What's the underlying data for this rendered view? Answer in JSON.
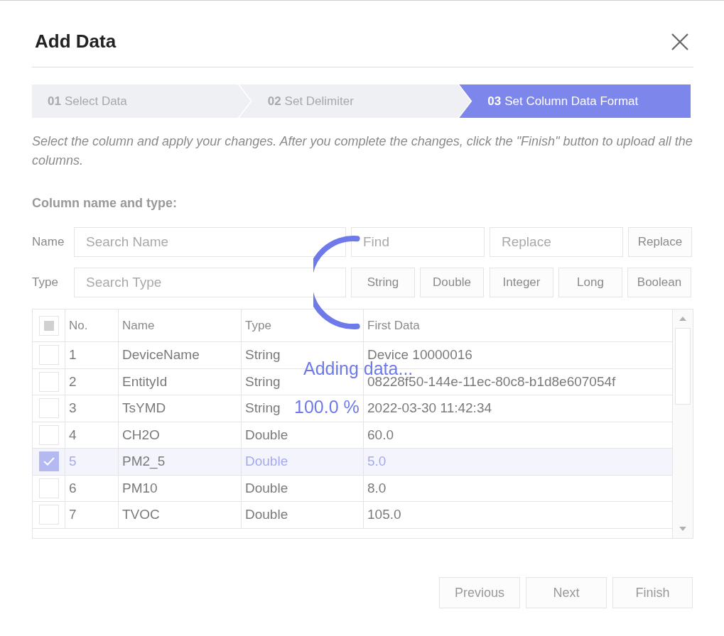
{
  "dialog": {
    "title": "Add Data"
  },
  "steps": [
    {
      "number": "01",
      "label": "Select Data",
      "selected": false
    },
    {
      "number": "02",
      "label": "Set Delimiter",
      "selected": false
    },
    {
      "number": "03",
      "label": "Set Column Data Format",
      "selected": true
    }
  ],
  "description": "Select the column and apply your changes. After you complete the changes, click the \"Finish\" button to upload all the columns.",
  "section_title": "Column name and type:",
  "name_row": {
    "label": "Name",
    "search": {
      "placeholder": "Search Name"
    },
    "find": {
      "placeholder": "Find"
    },
    "replace": {
      "placeholder": "Replace"
    },
    "button": "Replace"
  },
  "type_row": {
    "label": "Type",
    "search": {
      "placeholder": "Search Type"
    },
    "buttons": [
      "String",
      "Double",
      "Integer",
      "Long",
      "Boolean"
    ]
  },
  "table": {
    "select_all": {
      "partial": true
    },
    "columns": [
      "No.",
      "Name",
      "Type",
      "First Data"
    ],
    "rows": [
      {
        "no": "1",
        "name": "DeviceName",
        "type": "String",
        "first_data": "Device 10000016",
        "selected": false
      },
      {
        "no": "2",
        "name": "EntityId",
        "type": "String",
        "first_data": "08228f50-144e-11ec-80c8-b1d8e607054f",
        "selected": false
      },
      {
        "no": "3",
        "name": "TsYMD",
        "type": "String",
        "first_data": "2022-03-30 11:42:34",
        "selected": false
      },
      {
        "no": "4",
        "name": "CH2O",
        "type": "Double",
        "first_data": "60.0",
        "selected": false
      },
      {
        "no": "5",
        "name": "PM2_5",
        "type": "Double",
        "first_data": "5.0",
        "selected": true
      },
      {
        "no": "6",
        "name": "PM10",
        "type": "Double",
        "first_data": "8.0",
        "selected": false
      },
      {
        "no": "7",
        "name": "TVOC",
        "type": "Double",
        "first_data": "105.0",
        "selected": false
      }
    ]
  },
  "loading": {
    "message": "Adding data...",
    "percent": "100.0 %"
  },
  "buttons": [
    {
      "label": "Previous"
    },
    {
      "label": "Next"
    },
    {
      "label": "Finish"
    }
  ]
}
